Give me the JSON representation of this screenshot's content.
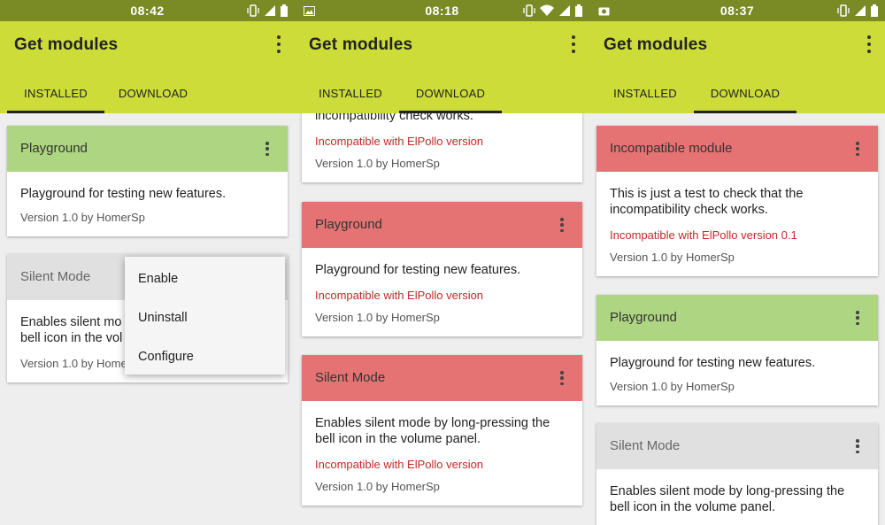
{
  "app": {
    "title": "Get modules",
    "tabs": [
      "INSTALLED",
      "DOWNLOAD"
    ]
  },
  "colors": {
    "status_bar": "#7a8a24",
    "app_bar": "#cddc39",
    "header_green": "#aed581",
    "header_red": "#e57373",
    "header_grey": "#e0e0e0",
    "warning_text": "#c62828"
  },
  "screens": [
    {
      "time": "08:42",
      "active_tab": "INSTALLED",
      "cards": [
        {
          "title": "Playground",
          "state": "enabled",
          "description": "Playground for testing new features.",
          "version": "Version 1.0 by HomerSp"
        },
        {
          "title": "Silent Mode",
          "state": "disabled",
          "description_line1": "Enables silent mo",
          "description_line2": "bell icon in the vol",
          "version": "Version 1.0 by Homer"
        }
      ],
      "popup_menu": [
        "Enable",
        "Uninstall",
        "Configure"
      ]
    },
    {
      "time": "08:18",
      "active_tab": "DOWNLOAD",
      "cards": [
        {
          "title": "",
          "state": "incompatible",
          "description_partial": "incompatibility check works.",
          "warning": "Incompatible with ElPollo version",
          "version": "Version 1.0 by HomerSp"
        },
        {
          "title": "Playground",
          "state": "incompatible",
          "description": "Playground for testing new features.",
          "warning": "Incompatible with ElPollo version",
          "version": "Version 1.0 by HomerSp"
        },
        {
          "title": "Silent Mode",
          "state": "incompatible",
          "description": "Enables silent mode by long-pressing the bell icon in the volume panel.",
          "warning": "Incompatible with ElPollo version",
          "version": "Version 1.0 by HomerSp"
        }
      ]
    },
    {
      "time": "08:37",
      "active_tab": "DOWNLOAD",
      "cards": [
        {
          "title": "Incompatible module",
          "state": "incompatible",
          "description": "This is just a test to check that the incompatibility check works.",
          "warning": "Incompatible with ElPollo version 0.1",
          "version": "Version 1.0 by HomerSp"
        },
        {
          "title": "Playground",
          "state": "enabled",
          "description": "Playground for testing new features.",
          "version": "Version 1.0 by HomerSp"
        },
        {
          "title": "Silent Mode",
          "state": "disabled",
          "description": "Enables silent mode by long-pressing the bell icon in the volume panel."
        }
      ]
    }
  ]
}
